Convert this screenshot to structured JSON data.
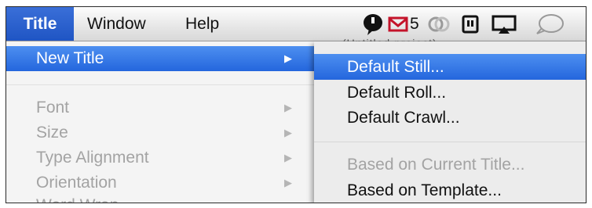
{
  "menubar": {
    "title": "Title",
    "window": "Window",
    "help": "Help",
    "mail_count": "5"
  },
  "left_menu": {
    "items": [
      {
        "label": "New Title",
        "arrow": "▶"
      },
      {
        "label": "Font",
        "arrow": "▶"
      },
      {
        "label": "Size",
        "arrow": "▶"
      },
      {
        "label": "Type Alignment",
        "arrow": "▶"
      },
      {
        "label": "Orientation",
        "arrow": "▶"
      },
      {
        "label": "Word Wrap"
      }
    ]
  },
  "submenu": {
    "items": [
      {
        "label": "Default Still..."
      },
      {
        "label": "Default Roll..."
      },
      {
        "label": "Default Crawl..."
      },
      {
        "label": "Based on Current Title..."
      },
      {
        "label": "Based on Template..."
      }
    ]
  },
  "background_window_title": "(Untitled project)",
  "colors": {
    "selection": "#2466dd",
    "disabled_text": "#a3a3a3"
  }
}
